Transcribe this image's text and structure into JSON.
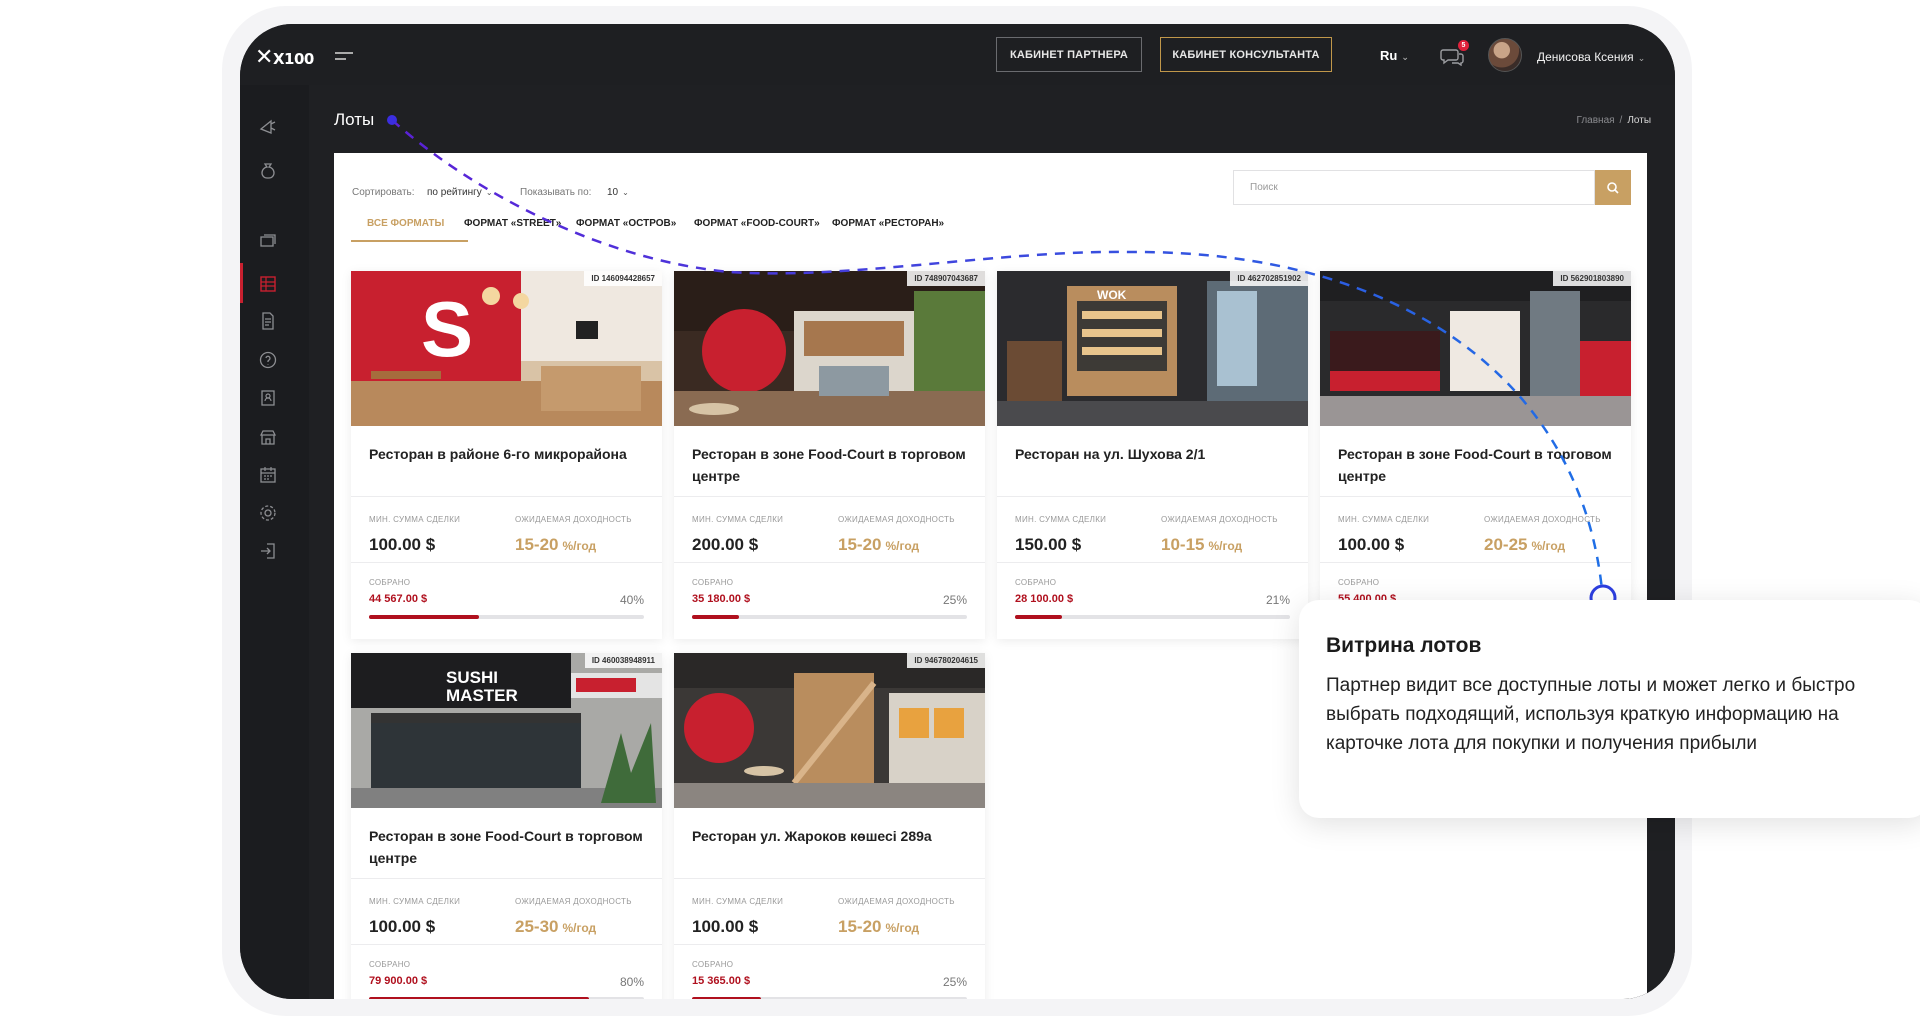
{
  "header": {
    "logo_text": "X100",
    "partner_btn": "КАБИНЕТ ПАРТНЕРА",
    "consultant_btn": "КАБИНЕТ КОНСУЛЬТАНТА",
    "lang": "Ru",
    "notif_count": "5",
    "user_name": "Денисова Ксения"
  },
  "page": {
    "title": "Лоты",
    "breadcrumb_home": "Главная",
    "breadcrumb_sep": "/",
    "breadcrumb_current": "Лоты"
  },
  "filters": {
    "sort_label": "Сортировать:",
    "sort_value": "по рейтингу",
    "show_label": "Показывать по:",
    "show_value": "10",
    "search_placeholder": "Поиск"
  },
  "tabs": [
    {
      "label": "ВСЕ ФОРМАТЫ",
      "active": true
    },
    {
      "label": "ФОРМАТ «STREET»"
    },
    {
      "label": "ФОРМАТ «ОСТРОВ»"
    },
    {
      "label": "ФОРМАТ «FOOD-COURT»"
    },
    {
      "label": "ФОРМАТ «РЕСТОРАН»"
    }
  ],
  "card_labels": {
    "min_deal": "МИН. СУММА СДЕЛКИ",
    "yield": "ОЖИДАЕМАЯ ДОХОДНОСТЬ",
    "collected": "СОБРАНО",
    "yield_unit": "%/год"
  },
  "lots": [
    {
      "id": "ID 146094428657",
      "title": "Ресторан в районе 6-го микрорайона",
      "min": "100.00 $",
      "yield": "15-20",
      "collected": "44 567.00 $",
      "percent": "40%",
      "progress": 0.4
    },
    {
      "id": "ID 748907043687",
      "title": "Ресторан в зоне Food-Court в торговом центре",
      "min": "200.00 $",
      "yield": "15-20",
      "collected": "35 180.00 $",
      "percent": "25%",
      "progress": 0.17
    },
    {
      "id": "ID 462702851902",
      "title": "Ресторан на ул. Шухова 2/1",
      "min": "150.00 $",
      "yield": "10-15",
      "collected": "28 100.00 $",
      "percent": "21%",
      "progress": 0.17
    },
    {
      "id": "ID 562901803890",
      "title": "Ресторан в зоне Food-Court в торговом центре",
      "min": "100.00 $",
      "yield": "20-25",
      "collected": "55 400.00 $",
      "percent": "",
      "progress": 0.3
    },
    {
      "id": "ID 460038948911",
      "title": "Ресторан в зоне Food-Court в торговом центре",
      "min": "100.00 $",
      "yield": "25-30",
      "collected": "79 900.00 $",
      "percent": "80%",
      "progress": 0.8
    },
    {
      "id": "ID 946780204615",
      "title": "Ресторан ул. Жароков көшесі 289а",
      "min": "100.00 $",
      "yield": "15-20",
      "collected": "15 365.00 $",
      "percent": "25%",
      "progress": 0.25
    }
  ],
  "callout": {
    "title": "Витрина лотов",
    "text": "Партнер видит все доступные лоты и может легко и быстро выбрать подходящий, используя краткую информацию на карточке лота для покупки и получения прибыли"
  },
  "colors": {
    "accent_gold": "#c8a063",
    "collected_red": "#b0101e",
    "dark_bg": "#1f2023",
    "annotation_blue": "#2d56e0"
  }
}
